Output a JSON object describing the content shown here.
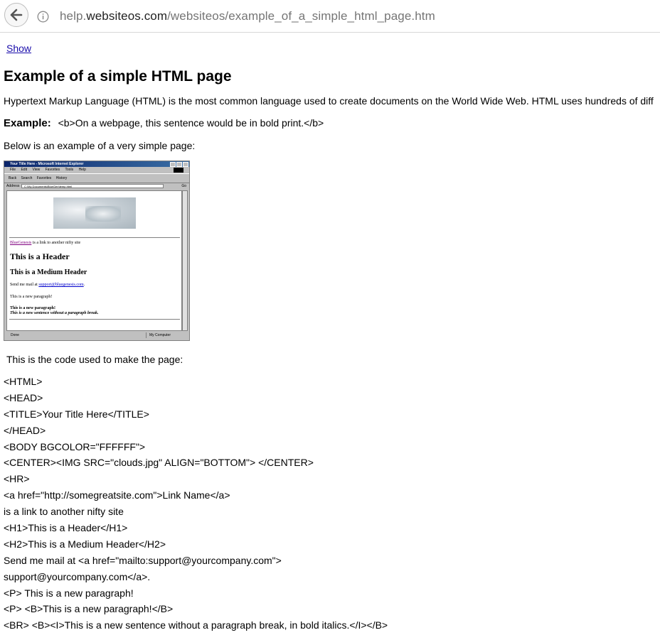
{
  "browser": {
    "url_prefix": "help.",
    "url_host": "websiteos.com",
    "url_path": "/websiteos/example_of_a_simple_html_page.htm"
  },
  "page": {
    "show_link": "Show",
    "title": "Example of a simple HTML page",
    "intro": "Hypertext Markup Language (HTML) is the most common language used to create documents on the World Wide Web. HTML uses hundreds of diff",
    "example_label": "Example:",
    "example_code": "<b>On a webpage, this sentence would be in bold print.</b>",
    "below_text": "Below is an example of a very simple page:",
    "code_intro": "This is the code used to make the page:",
    "code_lines": [
      "<HTML>",
      "<HEAD>",
      "<TITLE>Your Title Here</TITLE>",
      "</HEAD>",
      "<BODY BGCOLOR=\"FFFFFF\">",
      "<CENTER><IMG SRC=\"clouds.jpg\" ALIGN=\"BOTTOM\"> </CENTER>",
      "<HR>",
      "<a href=\"http://somegreatsite.com\">Link Name</a>",
      "is a link to another nifty site",
      "<H1>This is a Header</H1>",
      "<H2>This is a Medium Header</H2>",
      "Send me mail at <a href=\"mailto:support@yourcompany.com\">",
      "support@yourcompany.com</a>.",
      "<P> This is a new paragraph!",
      "<P> <B>This is a new paragraph!</B>",
      "<BR> <B><I>This is a new sentence without a paragraph break, in bold italics.</I></B>"
    ]
  },
  "screenshot": {
    "window_title": "Your Title Here - Microsoft Internet Explorer",
    "menu": [
      "File",
      "Edit",
      "View",
      "Favorites",
      "Tools",
      "Help"
    ],
    "toolbar": [
      "Back",
      "Search",
      "Favorites",
      "History"
    ],
    "address_label": "Address",
    "address_value": "C:\\My Documents\\BlueGen\\temp.html",
    "go_label": "Go",
    "link_text": "BlueGenesis",
    "link_suffix": " is a link to another nifty site",
    "h1": "This is a Header",
    "h2": "This is a Medium Header",
    "mail_prefix": "Send me mail at ",
    "mail_link": "support@bluegenesis.com",
    "para1": "This is a new paragraph!",
    "para2": "This is a new paragraph!",
    "para3": "This is a new sentence without a paragraph break.",
    "status_left": "Done",
    "status_right": "My Computer"
  }
}
